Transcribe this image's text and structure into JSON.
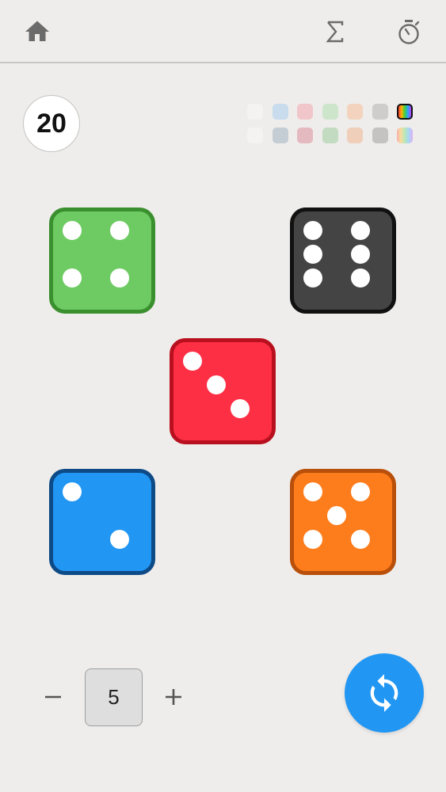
{
  "header": {
    "home_icon": "home-icon",
    "sum_icon": "sigma-icon",
    "timer_icon": "stopwatch-icon"
  },
  "score": {
    "total": "20"
  },
  "colors": {
    "accent": "#2196f3",
    "icon": "#6b6b6b",
    "background": "#efedeb"
  },
  "dice_colors": [
    "#6ecb63",
    "#444444",
    "#fd2f45",
    "#2196f3",
    "#fd7c1c"
  ],
  "dice": [
    {
      "name": "green",
      "fill": "#6ecb63",
      "border": "#3a8f2e",
      "value": 4
    },
    {
      "name": "black",
      "fill": "#444444",
      "border": "#111111",
      "value": 6
    },
    {
      "name": "red",
      "fill": "#fd2f45",
      "border": "#b8101f",
      "value": 3
    },
    {
      "name": "blue",
      "fill": "#2196f3",
      "border": "#0d4a86",
      "value": 2
    },
    {
      "name": "orange",
      "fill": "#fd7c1c",
      "border": "#b84f0a",
      "value": 5
    }
  ],
  "palette": {
    "rows": [
      [
        "#f4f3f1",
        "#c8dcee",
        "#f1c6ca",
        "#cde6cb",
        "#f3d3bd",
        "#cfcdcb",
        "rainbow"
      ],
      [
        "#f4f3f1",
        "#c4ccd4",
        "#e4b9bf",
        "#c3dcc1",
        "#efcfba",
        "#c5c3c1",
        "rainbow-light"
      ]
    ],
    "selected": [
      0,
      6
    ]
  },
  "stepper": {
    "minus_label": "−",
    "plus_label": "+",
    "count": "5"
  },
  "roll_button": {
    "icon": "refresh-icon"
  }
}
